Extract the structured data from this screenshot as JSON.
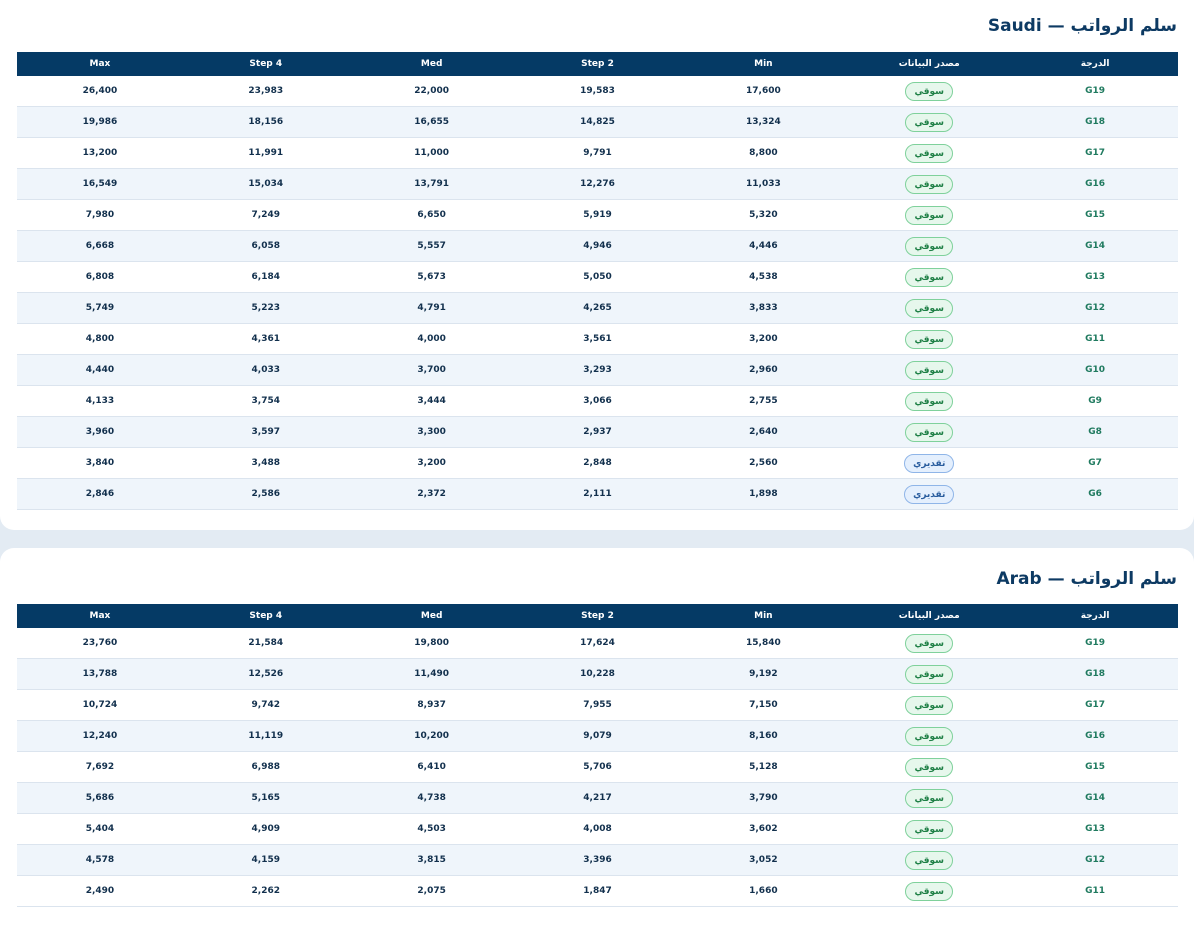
{
  "colors": {
    "header_bg": "#053a65",
    "title": "#0d3a63",
    "grade_text": "#1f7a5f",
    "market_pill_bg": "#e6f7ec",
    "market_pill_border": "#7fd19b",
    "estimate_pill_bg": "#e4effd",
    "estimate_pill_border": "#8fb5e8",
    "alt_row_bg": "#eff5fb"
  },
  "columns": {
    "max": "Max",
    "step4": "Step 4",
    "med": "Med",
    "step2": "Step 2",
    "min": "Min",
    "source": "مصدر البيانات",
    "grade": "الدرجة"
  },
  "tables": [
    {
      "title": "سلم الرواتب — Saudi",
      "rows": [
        {
          "grade": "G19",
          "source": "سوقي",
          "source_type": "market",
          "min": "17,600",
          "step2": "19,583",
          "med": "22,000",
          "step4": "23,983",
          "max": "26,400"
        },
        {
          "grade": "G18",
          "source": "سوقي",
          "source_type": "market",
          "min": "13,324",
          "step2": "14,825",
          "med": "16,655",
          "step4": "18,156",
          "max": "19,986"
        },
        {
          "grade": "G17",
          "source": "سوقي",
          "source_type": "market",
          "min": "8,800",
          "step2": "9,791",
          "med": "11,000",
          "step4": "11,991",
          "max": "13,200"
        },
        {
          "grade": "G16",
          "source": "سوقي",
          "source_type": "market",
          "min": "11,033",
          "step2": "12,276",
          "med": "13,791",
          "step4": "15,034",
          "max": "16,549"
        },
        {
          "grade": "G15",
          "source": "سوقي",
          "source_type": "market",
          "min": "5,320",
          "step2": "5,919",
          "med": "6,650",
          "step4": "7,249",
          "max": "7,980"
        },
        {
          "grade": "G14",
          "source": "سوقي",
          "source_type": "market",
          "min": "4,446",
          "step2": "4,946",
          "med": "5,557",
          "step4": "6,058",
          "max": "6,668"
        },
        {
          "grade": "G13",
          "source": "سوقي",
          "source_type": "market",
          "min": "4,538",
          "step2": "5,050",
          "med": "5,673",
          "step4": "6,184",
          "max": "6,808"
        },
        {
          "grade": "G12",
          "source": "سوقي",
          "source_type": "market",
          "min": "3,833",
          "step2": "4,265",
          "med": "4,791",
          "step4": "5,223",
          "max": "5,749"
        },
        {
          "grade": "G11",
          "source": "سوقي",
          "source_type": "market",
          "min": "3,200",
          "step2": "3,561",
          "med": "4,000",
          "step4": "4,361",
          "max": "4,800"
        },
        {
          "grade": "G10",
          "source": "سوقي",
          "source_type": "market",
          "min": "2,960",
          "step2": "3,293",
          "med": "3,700",
          "step4": "4,033",
          "max": "4,440"
        },
        {
          "grade": "G9",
          "source": "سوقي",
          "source_type": "market",
          "min": "2,755",
          "step2": "3,066",
          "med": "3,444",
          "step4": "3,754",
          "max": "4,133"
        },
        {
          "grade": "G8",
          "source": "سوقي",
          "source_type": "market",
          "min": "2,640",
          "step2": "2,937",
          "med": "3,300",
          "step4": "3,597",
          "max": "3,960"
        },
        {
          "grade": "G7",
          "source": "تقديري",
          "source_type": "estimate",
          "min": "2,560",
          "step2": "2,848",
          "med": "3,200",
          "step4": "3,488",
          "max": "3,840"
        },
        {
          "grade": "G6",
          "source": "تقديري",
          "source_type": "estimate",
          "min": "1,898",
          "step2": "2,111",
          "med": "2,372",
          "step4": "2,586",
          "max": "2,846"
        }
      ]
    },
    {
      "title": "سلم الرواتب — Arab",
      "rows": [
        {
          "grade": "G19",
          "source": "سوقي",
          "source_type": "market",
          "min": "15,840",
          "step2": "17,624",
          "med": "19,800",
          "step4": "21,584",
          "max": "23,760"
        },
        {
          "grade": "G18",
          "source": "سوقي",
          "source_type": "market",
          "min": "9,192",
          "step2": "10,228",
          "med": "11,490",
          "step4": "12,526",
          "max": "13,788"
        },
        {
          "grade": "G17",
          "source": "سوقي",
          "source_type": "market",
          "min": "7,150",
          "step2": "7,955",
          "med": "8,937",
          "step4": "9,742",
          "max": "10,724"
        },
        {
          "grade": "G16",
          "source": "سوقي",
          "source_type": "market",
          "min": "8,160",
          "step2": "9,079",
          "med": "10,200",
          "step4": "11,119",
          "max": "12,240"
        },
        {
          "grade": "G15",
          "source": "سوقي",
          "source_type": "market",
          "min": "5,128",
          "step2": "5,706",
          "med": "6,410",
          "step4": "6,988",
          "max": "7,692"
        },
        {
          "grade": "G14",
          "source": "سوقي",
          "source_type": "market",
          "min": "3,790",
          "step2": "4,217",
          "med": "4,738",
          "step4": "5,165",
          "max": "5,686"
        },
        {
          "grade": "G13",
          "source": "سوقي",
          "source_type": "market",
          "min": "3,602",
          "step2": "4,008",
          "med": "4,503",
          "step4": "4,909",
          "max": "5,404"
        },
        {
          "grade": "G12",
          "source": "سوقي",
          "source_type": "market",
          "min": "3,052",
          "step2": "3,396",
          "med": "3,815",
          "step4": "4,159",
          "max": "4,578"
        },
        {
          "grade": "G11",
          "source": "سوقي",
          "source_type": "market",
          "min": "1,660",
          "step2": "1,847",
          "med": "2,075",
          "step4": "2,262",
          "max": "2,490"
        }
      ]
    }
  ]
}
